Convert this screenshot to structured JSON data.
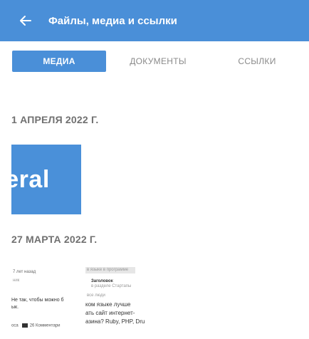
{
  "appbar": {
    "title": "Файлы, медиа и ссылки",
    "back_icon": "arrow-left-icon",
    "color": "#4a8fd8"
  },
  "tabs": [
    {
      "label": "МЕДИА",
      "active": true
    },
    {
      "label": "ДОКУМЕНТЫ",
      "active": false
    },
    {
      "label": "ССЫЛКИ",
      "active": false
    }
  ],
  "sections": [
    {
      "date": "1 АПРЕЛЯ 2022 Г.",
      "items": [
        {
          "text": "neral"
        }
      ]
    },
    {
      "date": "27 МАРТА 2022 Г.",
      "items": [
        {
          "left_meta": "7 лет назад",
          "left_sub": "ник",
          "left_line1": "Не так, чтобы можно б",
          "left_line2": "ык.",
          "left_footer_a": "оса",
          "left_footer_b": "26 Комментари",
          "right_header": "в языке в программе",
          "right_title": "Заголовок",
          "right_meta": "в разделе Стартапы",
          "right_sub": "все люди",
          "right_line1": "ком языке лучше",
          "right_line2": "ать сайт интернет-",
          "right_line3": "азина? Ruby, PHP, Dru"
        }
      ]
    }
  ]
}
